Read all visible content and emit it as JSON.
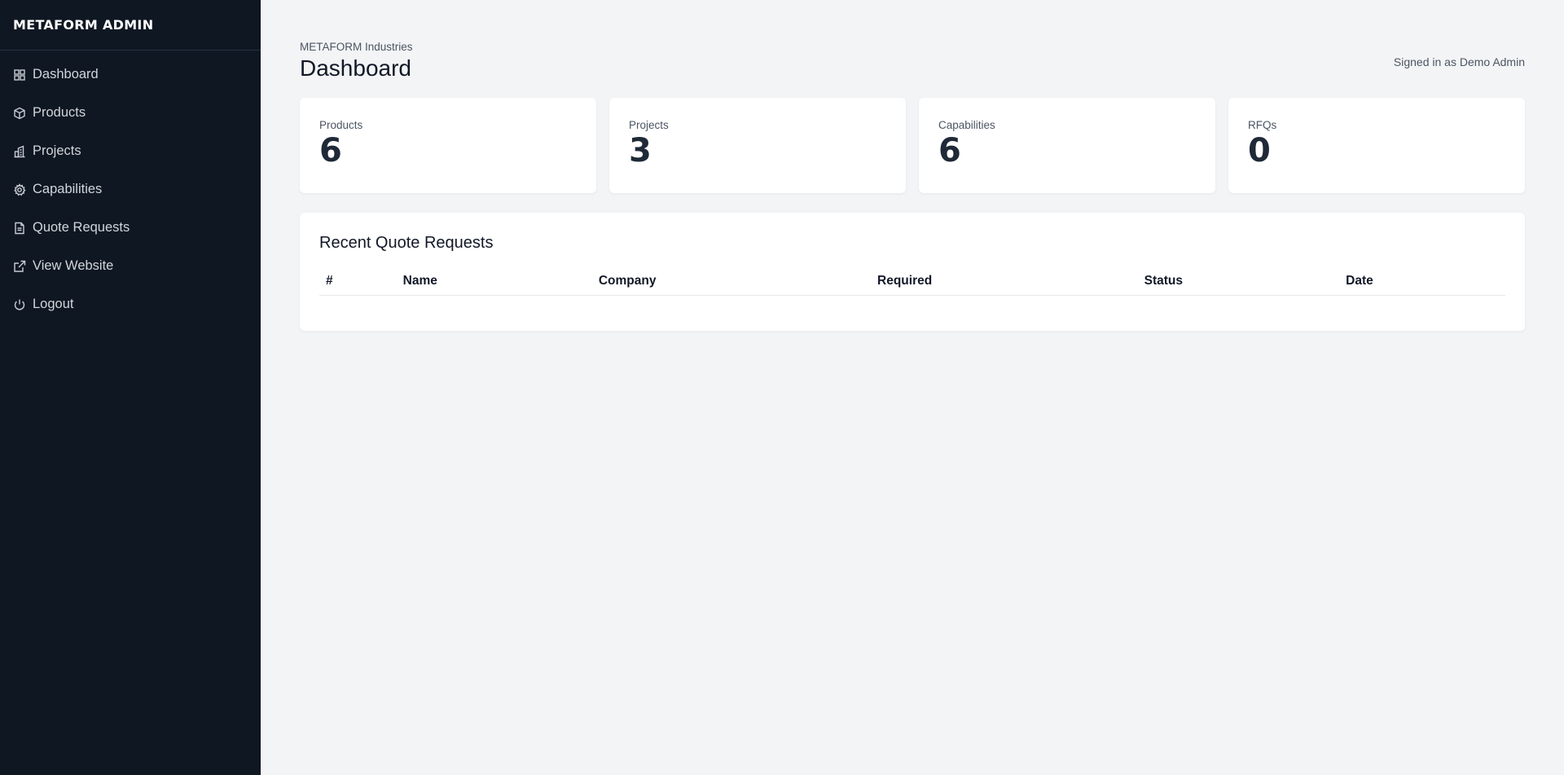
{
  "sidebar": {
    "brand": "METAFORM ADMIN",
    "items": [
      {
        "label": "Dashboard",
        "icon": "grid-icon"
      },
      {
        "label": "Products",
        "icon": "box-icon"
      },
      {
        "label": "Projects",
        "icon": "building-icon"
      },
      {
        "label": "Capabilities",
        "icon": "gear-icon"
      },
      {
        "label": "Quote Requests",
        "icon": "document-icon"
      },
      {
        "label": "View Website",
        "icon": "external-link-icon"
      },
      {
        "label": "Logout",
        "icon": "power-icon"
      }
    ]
  },
  "header": {
    "company": "METAFORM Industries",
    "title": "Dashboard",
    "signed_in": "Signed in as Demo Admin"
  },
  "stats": [
    {
      "label": "Products",
      "value": "6"
    },
    {
      "label": "Projects",
      "value": "3"
    },
    {
      "label": "Capabilities",
      "value": "6"
    },
    {
      "label": "RFQs",
      "value": "0"
    }
  ],
  "recent": {
    "title": "Recent Quote Requests",
    "columns": [
      "#",
      "Name",
      "Company",
      "Required",
      "Status",
      "Date"
    ],
    "rows": []
  },
  "colors": {
    "sidebar_bg": "#0f1722",
    "page_bg": "#f3f4f6",
    "card_bg": "#ffffff"
  }
}
